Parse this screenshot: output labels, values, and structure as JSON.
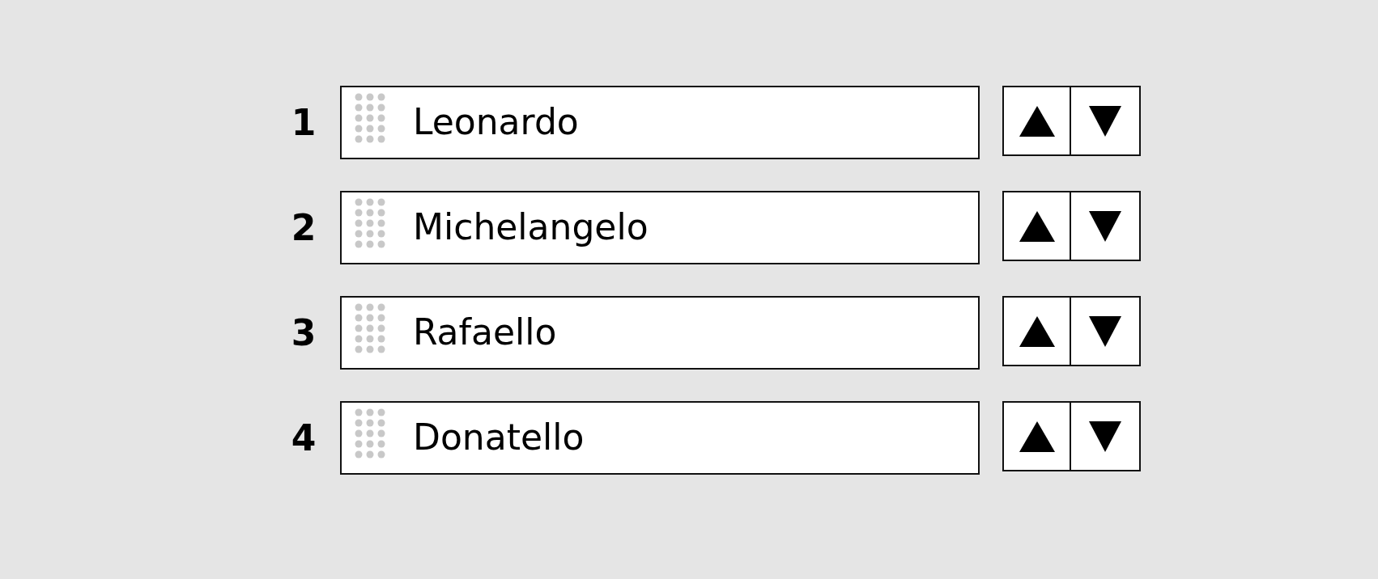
{
  "items": [
    {
      "rank": "1",
      "name": "Leonardo"
    },
    {
      "rank": "2",
      "name": "Michelangelo"
    },
    {
      "rank": "3",
      "name": "Rafaello"
    },
    {
      "rank": "4",
      "name": "Donatello"
    }
  ]
}
